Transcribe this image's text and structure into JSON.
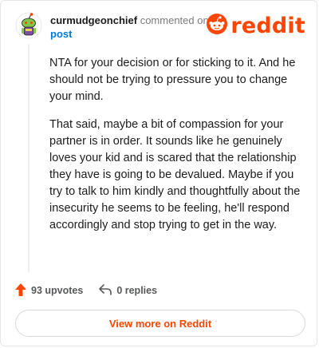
{
  "brand": {
    "wordmark": "reddit",
    "logo_icon": "snoo-icon",
    "color": "#ff4500"
  },
  "comment": {
    "author": "curmudgeonchief",
    "action": "commented on",
    "target": "post",
    "avatar_icon": "snoo-avatar-icon",
    "paragraphs": [
      "NTA for your decision or for sticking to it. And he should not be trying to pressure you to change your mind.",
      "That said, maybe a bit of compassion for your partner is in order. It sounds like he genuinely loves your kid and is scared that the relationship they have is going to be devalued. Maybe if you try to talk to him kindly and thoughtfully about the insecurity he seems to be feeling, he'll respond accordingly and stop trying to get in the way."
    ]
  },
  "footer": {
    "upvotes_label": "93 upvotes",
    "upvote_icon": "upvote-arrow-icon",
    "replies_label": "0 replies",
    "reply_icon": "reply-arrow-icon"
  },
  "cta": {
    "view_more_label": "View more on Reddit"
  }
}
